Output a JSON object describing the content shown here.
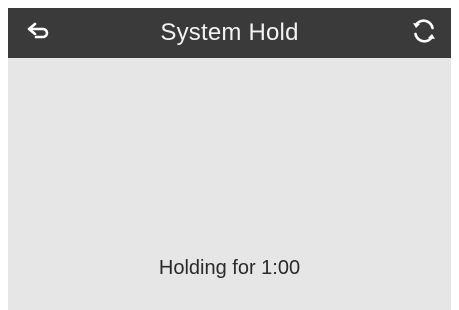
{
  "header": {
    "title": "System Hold",
    "back_icon": "back-arrow-icon",
    "refresh_icon": "refresh-icon"
  },
  "main": {
    "status_text": "Holding for 1:00"
  },
  "colors": {
    "header_bg": "#3a3a3a",
    "body_bg": "#e6e6e6",
    "header_text": "#f2f2f2",
    "body_text": "#2a2a2a"
  }
}
